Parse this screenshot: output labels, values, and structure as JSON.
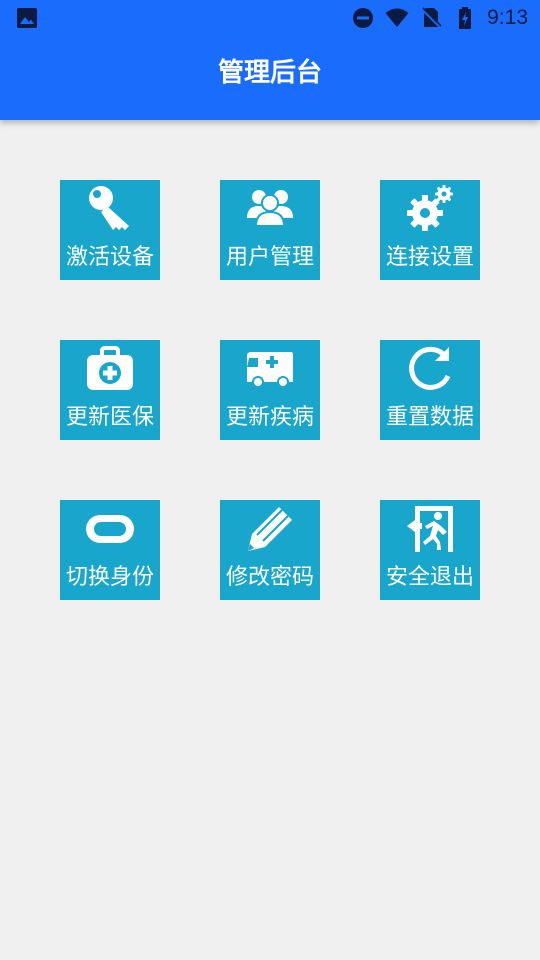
{
  "status_bar": {
    "time": "9:13",
    "left_icons": [
      "image-notification-icon"
    ],
    "right_icons": [
      "do-not-disturb-icon",
      "wifi-icon",
      "no-sim-icon",
      "battery-charging-icon"
    ]
  },
  "app_bar": {
    "title": "管理后台",
    "color": "#1a6cfc"
  },
  "menu": {
    "tile_color": "#19a6cc",
    "items": [
      {
        "label": "激活设备",
        "icon": "key-icon"
      },
      {
        "label": "用户管理",
        "icon": "users-icon"
      },
      {
        "label": "连接设置",
        "icon": "gears-icon"
      },
      {
        "label": "更新医保",
        "icon": "medical-kit-icon"
      },
      {
        "label": "更新疾病",
        "icon": "ambulance-icon"
      },
      {
        "label": "重置数据",
        "icon": "refresh-icon"
      },
      {
        "label": "切换身份",
        "icon": "toggle-icon"
      },
      {
        "label": "修改密码",
        "icon": "pencil-icon"
      },
      {
        "label": "安全退出",
        "icon": "exit-icon"
      }
    ]
  }
}
